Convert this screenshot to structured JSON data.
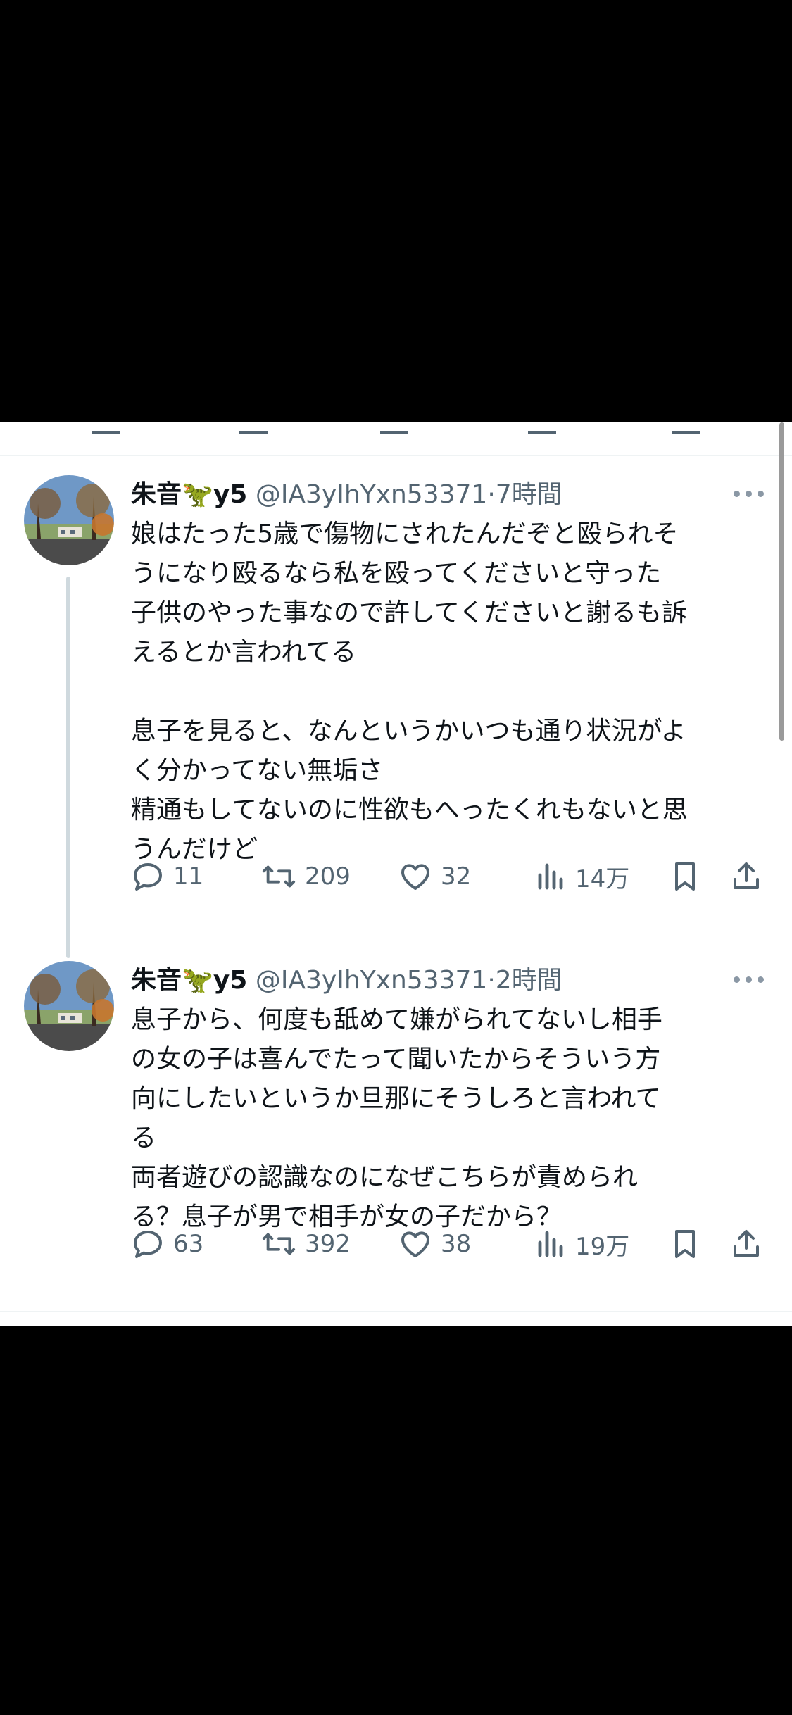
{
  "tweets": [
    {
      "name": "朱音",
      "name_emoji": "🦖",
      "name_suffix": "y5",
      "handle": "@IA3yIhYxn53371",
      "separator": "·",
      "time": "7時間",
      "text": "娘はたった5歳で傷物にされたんだぞと殴られそ\nうになり殴るなら私を殴ってくださいと守った\n子供のやった事なので許してくださいと謝るも訴\nえるとか言われてる\n\n息子を見ると、なんというかいつも通り状況がよ\nく分かってない無垢さ\n精通もしてないのに性欲もへったくれもないと思\nうんだけど",
      "replies": "11",
      "retweets": "209",
      "likes": "32",
      "views": "14万"
    },
    {
      "name": "朱音",
      "name_emoji": "🦖",
      "name_suffix": "y5",
      "handle": "@IA3yIhYxn53371",
      "separator": "·",
      "time": "2時間",
      "text": "息子から、何度も舐めて嫌がられてないし相手\nの女の子は喜んでたって聞いたからそういう方\n向にしたいというか旦那にそうしろと言われて\nる\n両者遊びの認識なのになぜこちらが責められ\nる？息子が男で相手が女の子だから？",
      "replies": "63",
      "retweets": "392",
      "likes": "38",
      "views": "19万"
    }
  ],
  "icons": {
    "reply": "reply-icon",
    "retweet": "retweet-icon",
    "like": "like-icon",
    "views": "views-icon",
    "bookmark": "bookmark-icon",
    "share": "share-icon",
    "more": "more-icon"
  },
  "colors": {
    "text": "#0f1419",
    "secondary": "#536471",
    "divider": "#eff3f4",
    "thread_line": "#cfd9de"
  }
}
